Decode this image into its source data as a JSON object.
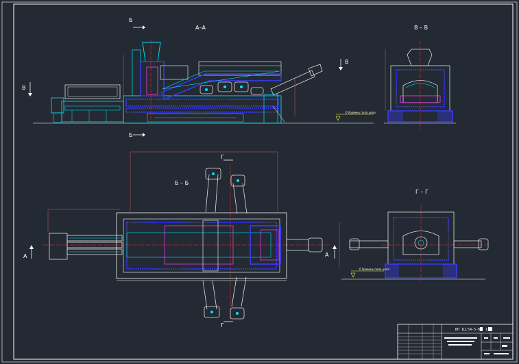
{
  "drawing": {
    "colors": {
      "background": "#232a33",
      "frame": "#ffffff",
      "body": "#00e5ff",
      "detail": "#3b3bff",
      "accent": "#ff3bff",
      "centerline": "#ff2a2a",
      "dimension": "#ff6a6a",
      "ground": "#ffff4a",
      "structure": "#e0e0e0"
    },
    "views": {
      "aa": {
        "title": "А–А",
        "marker_left": "Б",
        "marker_right": "Б",
        "marker_side": "В"
      },
      "bb": {
        "title": "В – В"
      },
      "bview": {
        "title": "Б – Б",
        "marker_a": "А",
        "marker_g": "Г"
      },
      "gg": {
        "title": "Г – Г"
      }
    },
    "level_note": "0 Уровень пола цеха",
    "title_block": {
      "code": "КП 1Ц.54-5-ВВ",
      "sheet": "12"
    }
  }
}
